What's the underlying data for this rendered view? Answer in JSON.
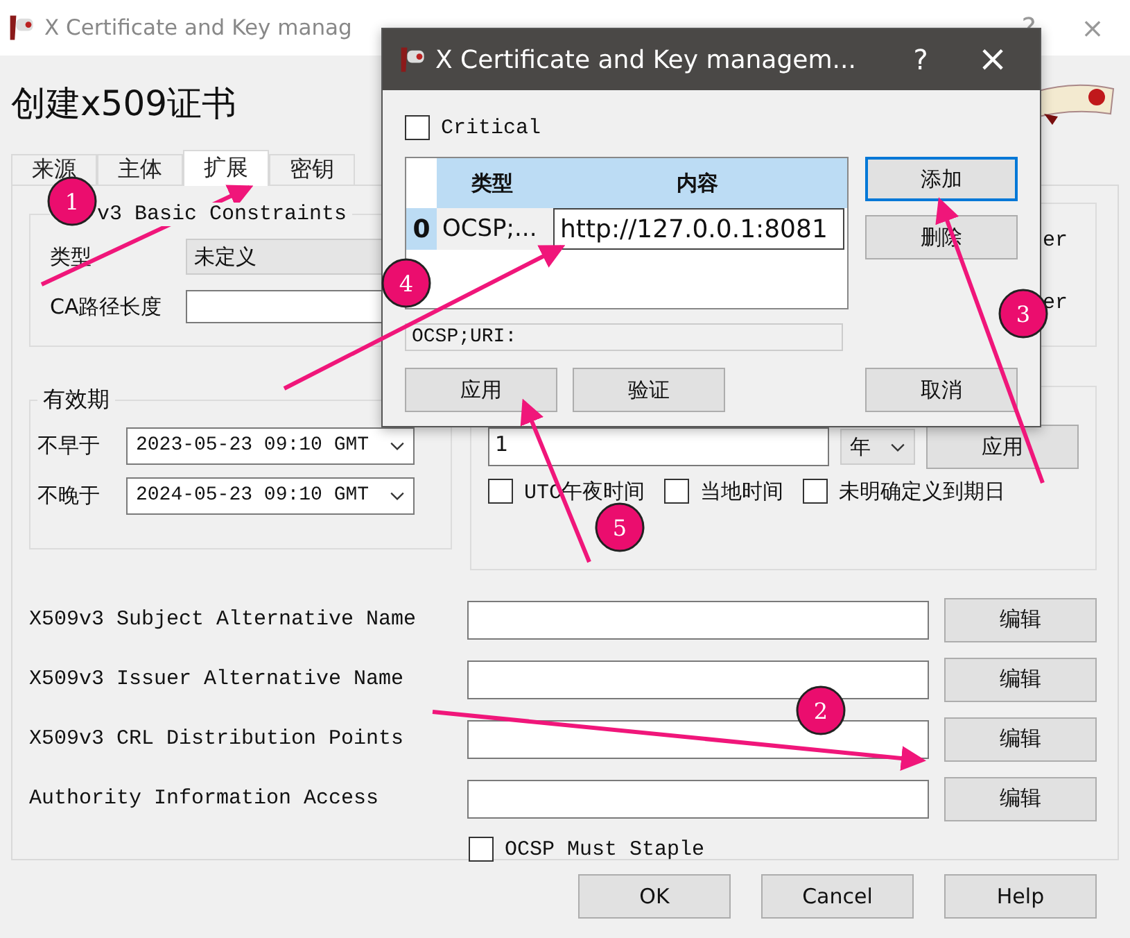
{
  "window": {
    "title": "X Certificate and Key manag",
    "help": "?",
    "close": "×"
  },
  "heading": "创建x509证书",
  "tabs": [
    {
      "label": "来源",
      "selected": false
    },
    {
      "label": "主体",
      "selected": false
    },
    {
      "label": "扩展",
      "selected": true
    },
    {
      "label": "密钥",
      "selected": false
    }
  ],
  "basic_constraints": {
    "title": "v3 Basic Constraints",
    "type_label": "类型",
    "type_value": "未定义",
    "path_label": "CA路径长度",
    "right_texts": [
      "er",
      "er"
    ]
  },
  "validity": {
    "title": "有效期",
    "not_before_label": "不早于",
    "not_before": "2023-05-23 09:10 GMT",
    "not_after_label": "不晚于",
    "not_after": "2024-05-23 09:10 GMT",
    "amount": "1",
    "unit": "年",
    "apply": "应用",
    "options": [
      {
        "label": "UTC午夜时间",
        "checked": false
      },
      {
        "label": "当地时间",
        "checked": false
      },
      {
        "label": "未明确定义到期日",
        "checked": false
      }
    ]
  },
  "extensions": [
    {
      "label": "X509v3 Subject Alternative Name",
      "button": "编辑"
    },
    {
      "label": "X509v3 Issuer Alternative Name",
      "button": "编辑"
    },
    {
      "label": "X509v3 CRL Distribution Points",
      "button": "编辑"
    },
    {
      "label": "Authority Information Access",
      "button": "编辑"
    }
  ],
  "ocsp_must_staple": {
    "label": "OCSP Must Staple",
    "checked": false
  },
  "buttons": [
    "OK",
    "Cancel",
    "Help"
  ],
  "dialog": {
    "title": "X Certificate and Key managem...",
    "help": "?",
    "close": "×",
    "critical": {
      "label": "Critical",
      "checked": false
    },
    "table": {
      "columns": [
        "类型",
        "内容"
      ],
      "rows": [
        {
          "index": "0",
          "type": "OCSP;...",
          "content": "http://127.0.0.1:8081"
        }
      ]
    },
    "preview": "OCSP;URI:",
    "side_buttons": [
      {
        "label": "添加",
        "focused": true
      },
      {
        "label": "删除",
        "focused": false
      }
    ],
    "bottom_buttons": [
      "应用",
      "验证"
    ],
    "cancel": "取消"
  },
  "markers": [
    "1",
    "2",
    "3",
    "4",
    "5"
  ]
}
